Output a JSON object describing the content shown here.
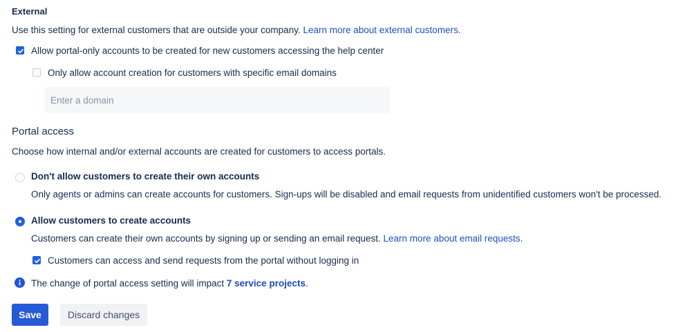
{
  "external": {
    "title": "External",
    "description": "Use this setting for external customers that are outside your company. ",
    "learn_more_link": "Learn more about external customers",
    "learn_more_suffix": ".",
    "allow_portal_only_label": "Allow portal-only accounts to be created for new customers accessing the help center",
    "allow_portal_only_checked": true,
    "restrict_domains_label": "Only allow account creation for customers with specific email domains",
    "restrict_domains_checked": false,
    "domain_input": {
      "value": "",
      "placeholder": "Enter a domain"
    }
  },
  "portal_access": {
    "title": "Portal access",
    "description": "Choose how internal and/or external accounts are created for customers to access portals.",
    "options": [
      {
        "label": "Don't allow customers to create their own accounts",
        "description": "Only agents or admins can create accounts for customers. Sign-ups will be disabled and email requests from unidentified customers won't be processed.",
        "selected": false
      },
      {
        "label": "Allow customers to create accounts",
        "description": "Customers can create their own accounts by signing up or sending an email request. ",
        "link": "Learn more about email requests",
        "link_suffix": ".",
        "selected": true
      }
    ],
    "anonymous_access_label": "Customers can access and send requests from the portal without logging in",
    "anonymous_access_checked": true
  },
  "info": {
    "text_prefix": "The change of portal access setting will impact ",
    "link": "7 service projects",
    "text_suffix": "."
  },
  "actions": {
    "save_label": "Save",
    "discard_label": "Discard changes"
  },
  "colors": {
    "primary": "#2559d6",
    "link": "#1f4fc2",
    "text": "#172b4d"
  }
}
